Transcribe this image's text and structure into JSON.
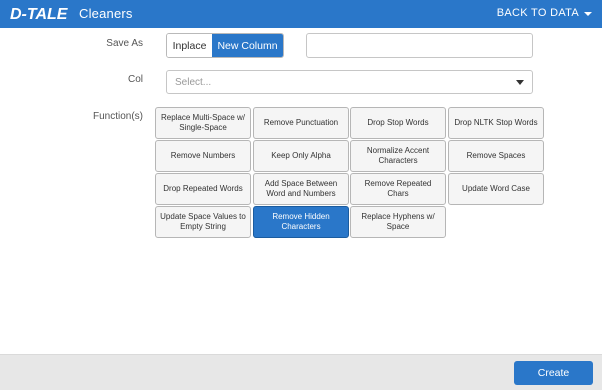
{
  "header": {
    "logo_text": "D-TALE",
    "title": "Cleaners",
    "back_label": "BACK TO DATA"
  },
  "form": {
    "save_as_label": "Save As",
    "save_as_options": [
      "Inplace",
      "New Column"
    ],
    "save_as_selected": "New Column",
    "new_column_name": "",
    "col_label": "Col",
    "col_placeholder": "Select...",
    "functions_label": "Function(s)"
  },
  "functions": [
    {
      "label": "Replace Multi-Space w/ Single-Space",
      "active": false
    },
    {
      "label": "Remove Punctuation",
      "active": false
    },
    {
      "label": "Drop Stop Words",
      "active": false
    },
    {
      "label": "Drop NLTK Stop Words",
      "active": false
    },
    {
      "label": "Remove Numbers",
      "active": false
    },
    {
      "label": "Keep Only Alpha",
      "active": false
    },
    {
      "label": "Normalize Accent Characters",
      "active": false
    },
    {
      "label": "Remove Spaces",
      "active": false
    },
    {
      "label": "Drop Repeated Words",
      "active": false
    },
    {
      "label": "Add Space Between Word and Numbers",
      "active": false
    },
    {
      "label": "Remove Repeated Chars",
      "active": false
    },
    {
      "label": "Update Word Case",
      "active": false
    },
    {
      "label": "Update Space Values to Empty String",
      "active": false
    },
    {
      "label": "Remove Hidden Characters",
      "active": true
    },
    {
      "label": "Replace Hyphens w/ Space",
      "active": false
    }
  ],
  "footer": {
    "create_label": "Create"
  },
  "colors": {
    "primary": "#2a77c9",
    "header_bg": "#2a77c9",
    "footer_bg": "#e7e7e7"
  }
}
